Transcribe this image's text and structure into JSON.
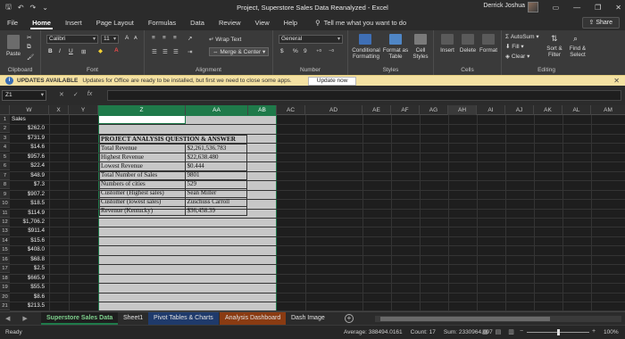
{
  "window": {
    "title": "Project, Superstore Sales Data Reanalyzed  -  Excel",
    "user": "Derrick Joshua"
  },
  "menu": {
    "tabs": [
      "File",
      "Home",
      "Insert",
      "Page Layout",
      "Formulas",
      "Data",
      "Review",
      "View",
      "Help"
    ],
    "active": "Home",
    "tell_me": "Tell me what you want to do",
    "share": "Share"
  },
  "ribbon": {
    "clipboard": {
      "label": "Clipboard",
      "paste": "Paste"
    },
    "font": {
      "label": "Font",
      "name": "Calibri",
      "size": "11",
      "bold": "B",
      "italic": "I",
      "underline": "U"
    },
    "alignment": {
      "label": "Alignment",
      "wrap_text": "Wrap Text",
      "merge_center": "Merge & Center"
    },
    "number": {
      "label": "Number",
      "format": "General",
      "currency": "$",
      "percent": "%",
      "comma": "9"
    },
    "styles": {
      "label": "Styles",
      "conditional": "Conditional Formatting",
      "format_table": "Format as Table",
      "cell_styles": "Cell Styles"
    },
    "cells": {
      "label": "Cells",
      "insert": "Insert",
      "delete": "Delete",
      "format": "Format"
    },
    "editing": {
      "label": "Editing",
      "autosum": "AutoSum",
      "fill": "Fill",
      "clear": "Clear",
      "sort_filter": "Sort & Filter",
      "find_select": "Find & Select"
    }
  },
  "banner": {
    "title": "UPDATES AVAILABLE",
    "message": "Updates for Office are ready to be installed, but first we need to close some apps.",
    "button": "Update now"
  },
  "formula_bar": {
    "name_box": "Z1",
    "cancel": "✕",
    "enter": "✓",
    "fx": "fx",
    "content": ""
  },
  "columns": [
    "W",
    "X",
    "Y",
    "Z",
    "AA",
    "AB",
    "AC",
    "AD",
    "AE",
    "AF",
    "AG",
    "AH",
    "AI",
    "AJ",
    "AK",
    "AL",
    "AM"
  ],
  "selected_columns": [
    "Z",
    "AA",
    "AB"
  ],
  "rows": [
    "1",
    "2",
    "3",
    "4",
    "5",
    "6",
    "7",
    "8",
    "9",
    "10",
    "11",
    "12",
    "13",
    "14",
    "15",
    "16",
    "17",
    "18",
    "19",
    "20",
    "21"
  ],
  "column_w": [
    "Sales",
    "$262.0",
    "$731.9",
    "$14.6",
    "$957.6",
    "$22.4",
    "$48.9",
    "$7.3",
    "$907.2",
    "$18.5",
    "$114.9",
    "$1,706.2",
    "$911.4",
    "$15.6",
    "$408.0",
    "$68.8",
    "$2.5",
    "$665.9",
    "$55.5",
    "$8.6",
    "$213.5"
  ],
  "analysis_table": {
    "header": "PROJECT ANALYSIS QUESTION & ANSWER",
    "rows": [
      {
        "label": "Total Revenue",
        "value": "$2,261,536.783"
      },
      {
        "label": "Highest Revenue",
        "value": "$22,638.480"
      },
      {
        "label": "Lowest Revenue",
        "value": "$0.444"
      },
      {
        "label": "Total Number of Sales",
        "value": "9801"
      },
      {
        "label": "Numbers of cities",
        "value": "529"
      },
      {
        "label": "Customer (Highest sales)",
        "value": "Sean Miller"
      },
      {
        "label": "Customer (lowest sales)",
        "value": "Zuschuss Carroll"
      },
      {
        "label": "Revenue (Kentucky)",
        "value": "$36,458.39"
      }
    ]
  },
  "sheets": {
    "tabs": [
      "Superstore Sales Data",
      "Sheet1",
      "Pivot Tables & Charts",
      "Analysis Dashboard",
      "Dash Image"
    ],
    "active": "Superstore Sales Data",
    "tab_colors": {
      "Pivot Tables & Charts": "#1f3a6b",
      "Analysis Dashboard": "#8a3b12"
    }
  },
  "status": {
    "mode": "Ready",
    "average": "Average: 388494.0161",
    "count": "Count: 17",
    "sum": "Sum: 2330964.097",
    "zoom": "100%"
  },
  "colors": {
    "accent": "#1f7a4a",
    "banner": "#f4e1a2"
  }
}
